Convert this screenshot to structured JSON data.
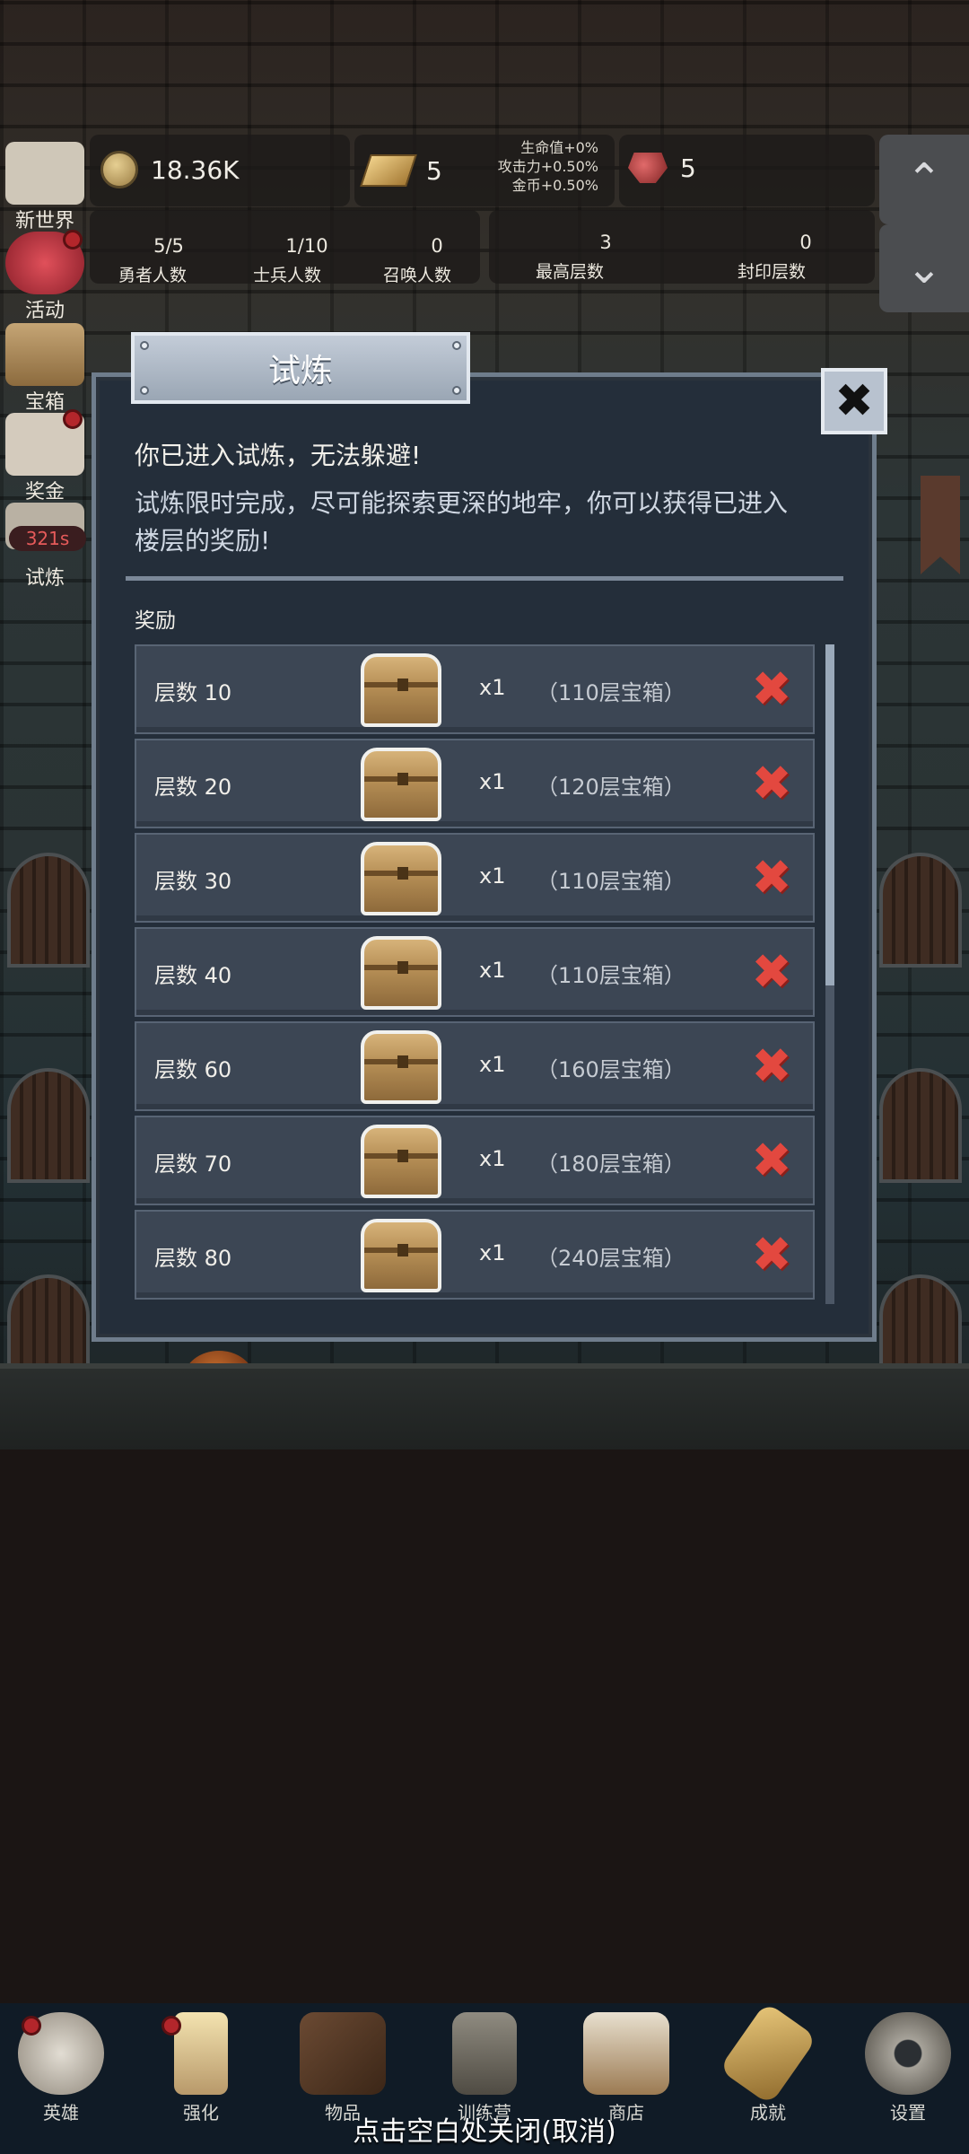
{
  "hud": {
    "gold": "18.36K",
    "ingot": "5",
    "bonus": [
      "生命值+0%",
      "攻击力+0.50%",
      "金币+0.50%"
    ],
    "gem": "5",
    "stats": [
      {
        "num": "5/5",
        "label": "勇者人数"
      },
      {
        "num": "1/10",
        "label": "士兵人数"
      },
      {
        "num": "0",
        "label": "召唤人数"
      },
      {
        "num": "3",
        "label": "最高层数"
      },
      {
        "num": "0",
        "label": "封印层数"
      }
    ],
    "scroll_up": "⌃",
    "scroll_down": "⌄"
  },
  "side": {
    "items": [
      "新世界",
      "活动",
      "宝箱",
      "奖金",
      "试炼"
    ],
    "timer": "321s"
  },
  "dialog": {
    "title": "试炼",
    "close": "✖",
    "line1": "你已进入试炼，无法躲避!",
    "line2a": "试炼限时完成，尽可能探索更深的地牢，你可以获得已进入",
    "line2b": "楼层的奖励!",
    "reward_heading": "奖励",
    "rewards": [
      {
        "floor": "层数 10",
        "qty": "x1",
        "box": "（110层宝箱）"
      },
      {
        "floor": "层数 20",
        "qty": "x1",
        "box": "（120层宝箱）"
      },
      {
        "floor": "层数 30",
        "qty": "x1",
        "box": "（110层宝箱）"
      },
      {
        "floor": "层数 40",
        "qty": "x1",
        "box": "（110层宝箱）"
      },
      {
        "floor": "层数 60",
        "qty": "x1",
        "box": "（160层宝箱）"
      },
      {
        "floor": "层数 70",
        "qty": "x1",
        "box": "（180层宝箱）"
      },
      {
        "floor": "层数 80",
        "qty": "x1",
        "box": "（240层宝箱）"
      }
    ],
    "x_glyph": "✖"
  },
  "tabs": [
    "英雄",
    "强化",
    "物品",
    "训练营",
    "商店",
    "成就",
    "设置"
  ],
  "close_hint": "点击空白处关闭(取消)",
  "colors": {
    "panel": "#242e3a",
    "row": "#3c4654",
    "reject": "#e3483f",
    "tabbar": "#101b26"
  }
}
